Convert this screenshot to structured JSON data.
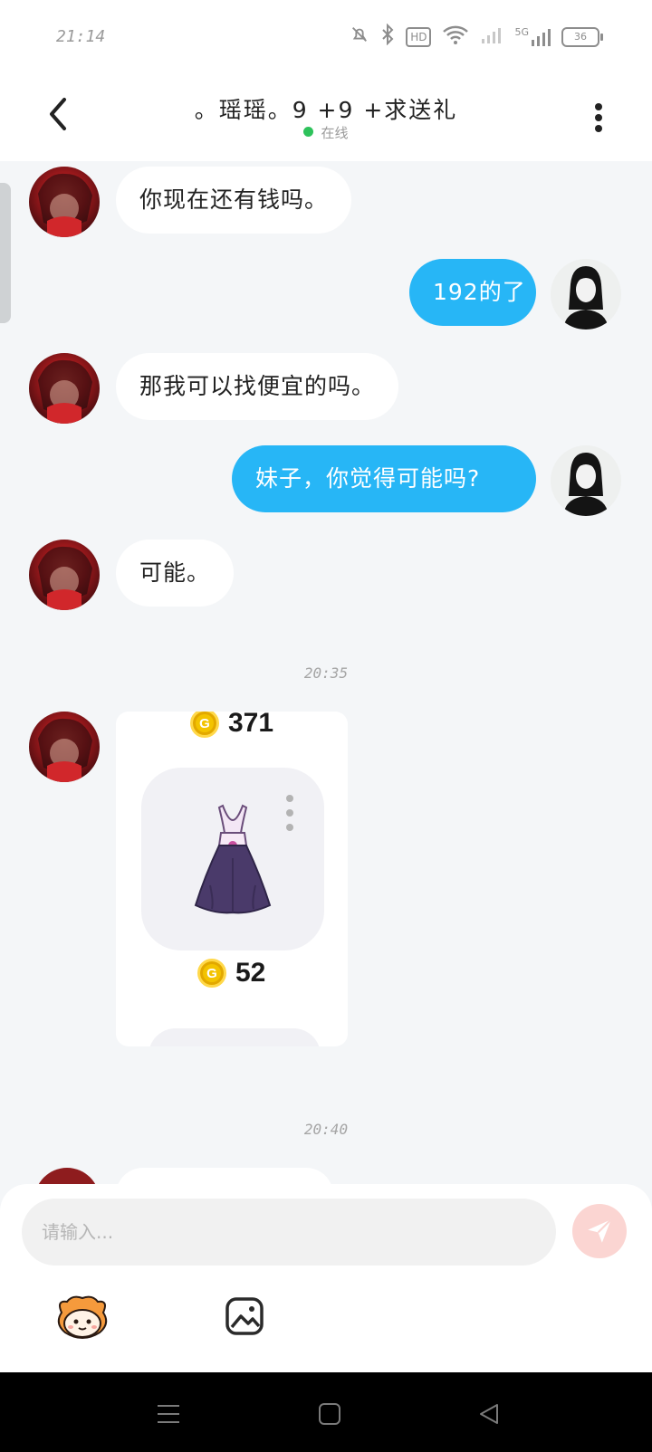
{
  "status_bar": {
    "time": "21:14",
    "hd_label": "HD",
    "network_label": "5G",
    "battery": "36"
  },
  "header": {
    "title": "。瑶瑶。9 +9 +求送礼",
    "status": "在线"
  },
  "messages": [
    {
      "side": "in",
      "text": "你现在还有钱吗。"
    },
    {
      "side": "out",
      "text": "192的了"
    },
    {
      "side": "in",
      "text": "那我可以找便宜的吗。"
    },
    {
      "side": "out",
      "text": "妹子，你觉得可能吗?"
    },
    {
      "side": "in",
      "text": "可能。"
    }
  ],
  "timestamps": [
    "20:35",
    "20:40"
  ],
  "gift_card": {
    "top_price": "371",
    "item_name": "dress",
    "item_price": "52",
    "coin_glyph": "G"
  },
  "composer": {
    "placeholder": "请输入..."
  },
  "colors": {
    "outgoing_bubble": "#27b6f6",
    "incoming_bubble": "#ffffff",
    "online_dot": "#2ec25b",
    "send_button": "#fbd5d2",
    "coin": "#f3c300"
  },
  "icons": [
    "back-arrow-icon",
    "more-vertical-icon",
    "send-icon",
    "mascot-emoji-icon",
    "image-icon",
    "nav-menu-icon",
    "nav-home-icon",
    "nav-back-icon"
  ]
}
